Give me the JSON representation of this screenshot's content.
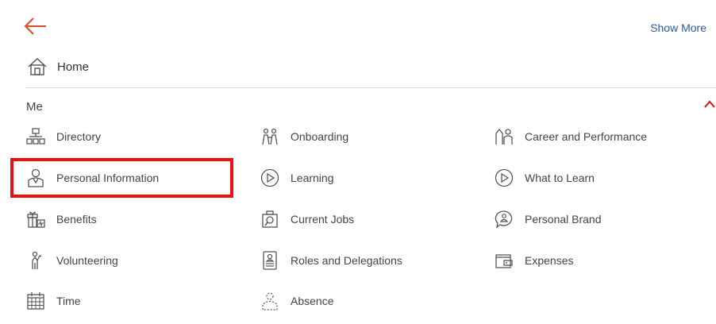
{
  "nav": {
    "show_more_label": "Show More",
    "home_label": "Home"
  },
  "section": {
    "title": "Me"
  },
  "items": [
    {
      "label": "Directory",
      "icon": "directory-icon"
    },
    {
      "label": "Onboarding",
      "icon": "onboarding-icon"
    },
    {
      "label": "Career and Performance",
      "icon": "career-icon"
    },
    {
      "label": "Personal Information",
      "icon": "person-icon"
    },
    {
      "label": "Learning",
      "icon": "play-circle-icon"
    },
    {
      "label": "What to Learn",
      "icon": "play-circle-icon"
    },
    {
      "label": "Benefits",
      "icon": "gift-icon"
    },
    {
      "label": "Current Jobs",
      "icon": "search-jobs-icon"
    },
    {
      "label": "Personal Brand",
      "icon": "chat-person-icon"
    },
    {
      "label": "Volunteering",
      "icon": "volunteer-icon"
    },
    {
      "label": "Roles and Delegations",
      "icon": "badge-icon"
    },
    {
      "label": "Expenses",
      "icon": "wallet-icon"
    },
    {
      "label": "Time",
      "icon": "calendar-icon"
    },
    {
      "label": "Absence",
      "icon": "absence-icon"
    }
  ],
  "colors": {
    "accent": "#e8110f",
    "link": "#2a5d9f",
    "divider": "#d7dde6"
  }
}
